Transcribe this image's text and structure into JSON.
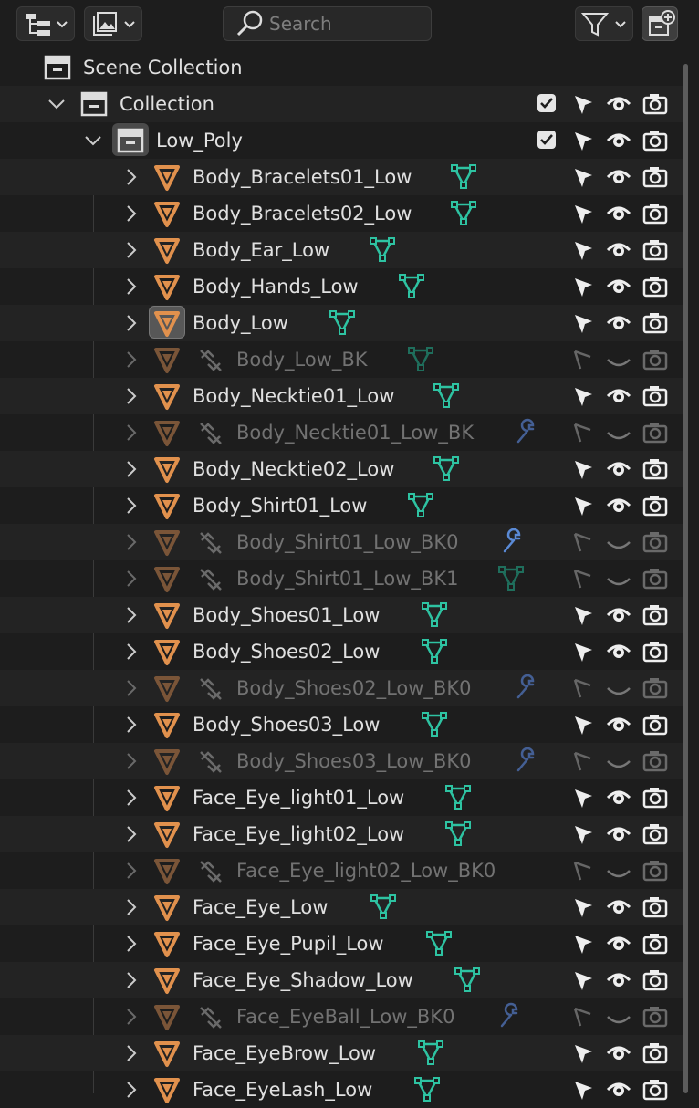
{
  "header": {
    "display_mode_icon": "outliner-display-mode-icon",
    "filter_icon": "filter-icon",
    "search_placeholder": "Search",
    "new_collection_icon": "new-collection-icon"
  },
  "colors": {
    "background": "#1d1d1d",
    "row_alt": "#232323",
    "mesh_orange": "#e1914d",
    "mesh_data_teal": "#2ec3a2",
    "modifier_blue": "#5a8ad6",
    "text": "#e0e0e0",
    "text_dim": "#727272"
  },
  "scene_collection": {
    "label": "Scene Collection"
  },
  "collection": {
    "label": "Collection"
  },
  "low_poly": {
    "label": "Low_Poly"
  },
  "objects": [
    {
      "label": "Body_Bracelets01_Low",
      "state": "normal",
      "data_icon": "mesh"
    },
    {
      "label": "Body_Bracelets02_Low",
      "state": "normal",
      "data_icon": "mesh"
    },
    {
      "label": "Body_Ear_Low",
      "state": "normal",
      "data_icon": "mesh"
    },
    {
      "label": "Body_Hands_Low",
      "state": "normal",
      "data_icon": "mesh"
    },
    {
      "label": "Body_Low",
      "state": "active",
      "data_icon": "mesh"
    },
    {
      "label": "Body_Low_BK",
      "state": "disabled",
      "data_icon": "mesh"
    },
    {
      "label": "Body_Necktie01_Low",
      "state": "normal",
      "data_icon": "mesh"
    },
    {
      "label": "Body_Necktie01_Low_BK",
      "state": "disabled",
      "data_icon": "wrench"
    },
    {
      "label": "Body_Necktie02_Low",
      "state": "normal",
      "data_icon": "mesh"
    },
    {
      "label": "Body_Shirt01_Low",
      "state": "normal",
      "data_icon": "mesh"
    },
    {
      "label": "Body_Shirt01_Low_BK0",
      "state": "disabled",
      "data_icon": "wrench"
    },
    {
      "label": "Body_Shirt01_Low_BK1",
      "state": "disabled",
      "data_icon": "mesh"
    },
    {
      "label": "Body_Shoes01_Low",
      "state": "normal",
      "data_icon": "mesh"
    },
    {
      "label": "Body_Shoes02_Low",
      "state": "normal",
      "data_icon": "mesh"
    },
    {
      "label": "Body_Shoes02_Low_BK0",
      "state": "disabled",
      "data_icon": "wrench"
    },
    {
      "label": "Body_Shoes03_Low",
      "state": "normal",
      "data_icon": "mesh"
    },
    {
      "label": "Body_Shoes03_Low_BK0",
      "state": "disabled",
      "data_icon": "wrench"
    },
    {
      "label": "Face_Eye_light01_Low",
      "state": "normal",
      "data_icon": "mesh"
    },
    {
      "label": "Face_Eye_light02_Low",
      "state": "normal",
      "data_icon": "mesh"
    },
    {
      "label": "Face_Eye_light02_Low_BK0",
      "state": "disabled",
      "data_icon": "none"
    },
    {
      "label": "Face_Eye_Low",
      "state": "normal",
      "data_icon": "mesh"
    },
    {
      "label": "Face_Eye_Pupil_Low",
      "state": "normal",
      "data_icon": "mesh"
    },
    {
      "label": "Face_Eye_Shadow_Low",
      "state": "normal",
      "data_icon": "mesh"
    },
    {
      "label": "Face_EyeBall_Low_BK0",
      "state": "disabled",
      "data_icon": "wrench"
    },
    {
      "label": "Face_EyeBrow_Low",
      "state": "normal",
      "data_icon": "mesh"
    },
    {
      "label": "Face_EyeLash_Low",
      "state": "normal",
      "data_icon": "mesh"
    }
  ]
}
